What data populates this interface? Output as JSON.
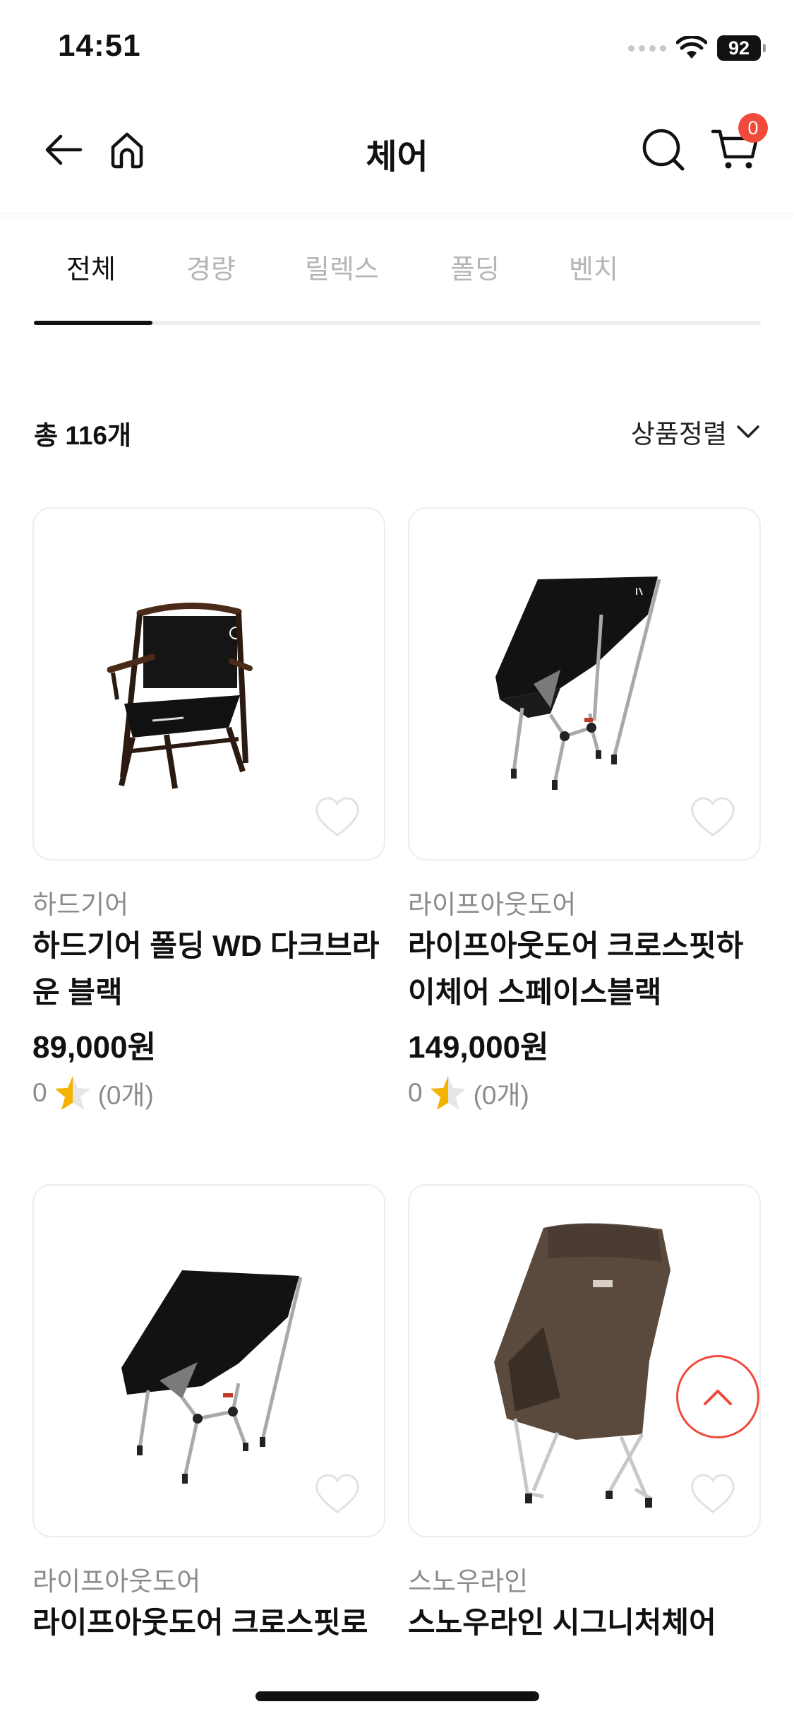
{
  "status": {
    "time": "14:51",
    "battery": "92"
  },
  "header": {
    "title": "체어",
    "cart_count": "0",
    "icons": {
      "back": "arrow-left-icon",
      "home": "home-icon",
      "search": "search-icon",
      "cart": "cart-icon"
    }
  },
  "tabs": [
    {
      "label": "전체",
      "active": true
    },
    {
      "label": "경량",
      "active": false
    },
    {
      "label": "릴렉스",
      "active": false
    },
    {
      "label": "폴딩",
      "active": false
    },
    {
      "label": "벤치",
      "active": false
    }
  ],
  "listing": {
    "total": "총 116개",
    "sort_label": "상품정렬"
  },
  "products": [
    {
      "brand": "하드기어",
      "name": "하드기어 폴딩 WD 다크브라운 블랙",
      "price": "89,000원",
      "rating": "0",
      "reviews": "(0개)"
    },
    {
      "brand": "라이프아웃도어",
      "name": "라이프아웃도어 크로스핏하이체어 스페이스블랙",
      "price": "149,000원",
      "rating": "0",
      "reviews": "(0개)"
    },
    {
      "brand": "라이프아웃도어",
      "name": "라이프아웃도어 크로스핏로",
      "price": "",
      "rating": "",
      "reviews": ""
    },
    {
      "brand": "스노우라인",
      "name": "스노우라인 시그니처체어",
      "price": "",
      "rating": "",
      "reviews": ""
    }
  ],
  "colors": {
    "accent": "#f04a3b",
    "star": "#f5b301",
    "muted": "#8b8b8b"
  }
}
